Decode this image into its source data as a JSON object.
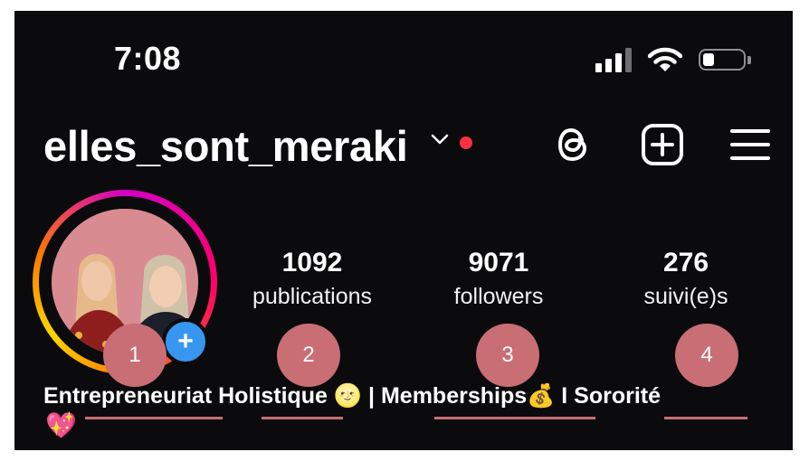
{
  "status_bar": {
    "time": "7:08",
    "signal_icon": "cellular-signal-icon",
    "wifi_icon": "wifi-icon",
    "battery_icon": "battery-icon"
  },
  "header": {
    "username": "elles_sont_meraki",
    "chevron_icon": "chevron-down-icon",
    "notification_dot_color": "#ff3040",
    "threads_icon": "threads-icon",
    "create_icon": "plus-square-icon",
    "menu_icon": "hamburger-menu-icon"
  },
  "profile": {
    "add_story_symbol": "+",
    "stats": [
      {
        "value": "1092",
        "label": "publications"
      },
      {
        "value": "9071",
        "label": "followers"
      },
      {
        "value": "276",
        "label": "suivi(e)s"
      }
    ]
  },
  "bio": {
    "part1": "Entrepreneuriat",
    "part2": "Holistique",
    "emoji1": "🌝",
    "sep1": "|",
    "part3": "Memberships",
    "emoji2": "💰",
    "sep2": "I",
    "part4": "Sororité",
    "emoji3": "💖"
  },
  "annotations": {
    "markers": [
      "1",
      "2",
      "3",
      "4"
    ],
    "color": "#c86e74"
  },
  "colors": {
    "background": "#0b0b0d",
    "text": "#ffffff",
    "accent_blue": "#3797f0"
  }
}
